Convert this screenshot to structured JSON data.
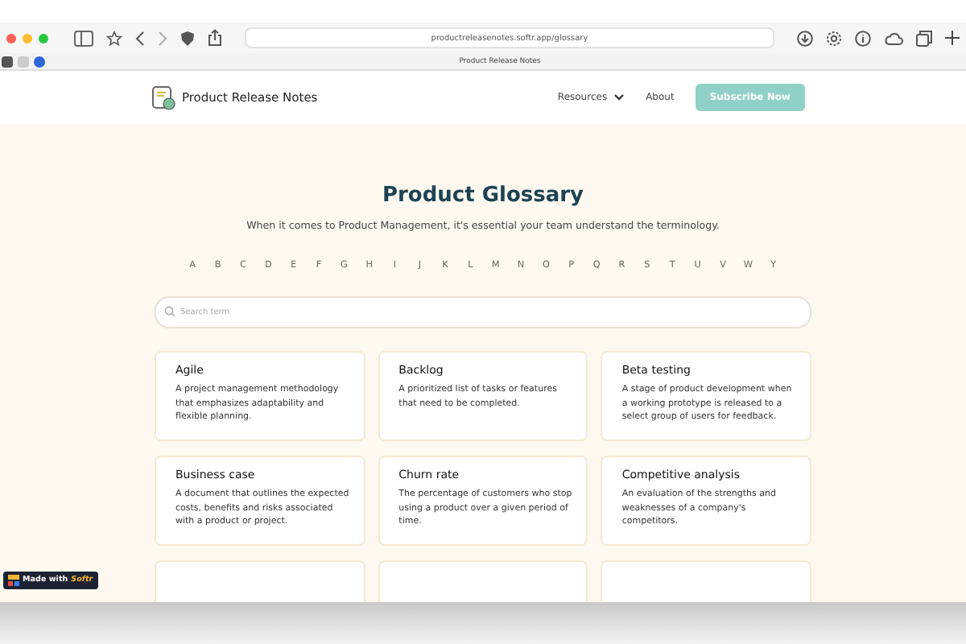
{
  "browser": {
    "url": "productreleasenotes.softr.app/glossary",
    "tab_title": "Product Release Notes"
  },
  "header": {
    "brand": "Product Release Notes",
    "nav": [
      {
        "label": "Resources",
        "dropdown": true
      },
      {
        "label": "About",
        "dropdown": false
      }
    ],
    "cta": "Subscribe Now"
  },
  "hero": {
    "title": "Product Glossary",
    "subtitle": "When it comes to Product Management, it's essential your team understand the terminology."
  },
  "letters": [
    "A",
    "B",
    "C",
    "D",
    "E",
    "F",
    "G",
    "H",
    "I",
    "J",
    "K",
    "L",
    "M",
    "N",
    "O",
    "P",
    "Q",
    "R",
    "S",
    "T",
    "U",
    "V",
    "W",
    "Y"
  ],
  "search": {
    "placeholder": "Search term"
  },
  "terms": [
    {
      "term": "Agile",
      "definition": "A project management methodology that emphasizes adaptability and flexible planning."
    },
    {
      "term": "Backlog",
      "definition": "A prioritized list of tasks or features that need to be completed."
    },
    {
      "term": "Beta testing",
      "definition": "A stage of product development when a working prototype is released to a select group of users for feedback."
    },
    {
      "term": "Business case",
      "definition": "A document that outlines the expected costs, benefits and risks associated with a product or project."
    },
    {
      "term": "Churn rate",
      "definition": "The percentage of customers who stop using a product over a given period of time."
    },
    {
      "term": "Competitive analysis",
      "definition": "An evaluation of the strengths and weaknesses of a company's competitors."
    }
  ],
  "badge": {
    "text": "Made with",
    "brand": "Softr"
  }
}
